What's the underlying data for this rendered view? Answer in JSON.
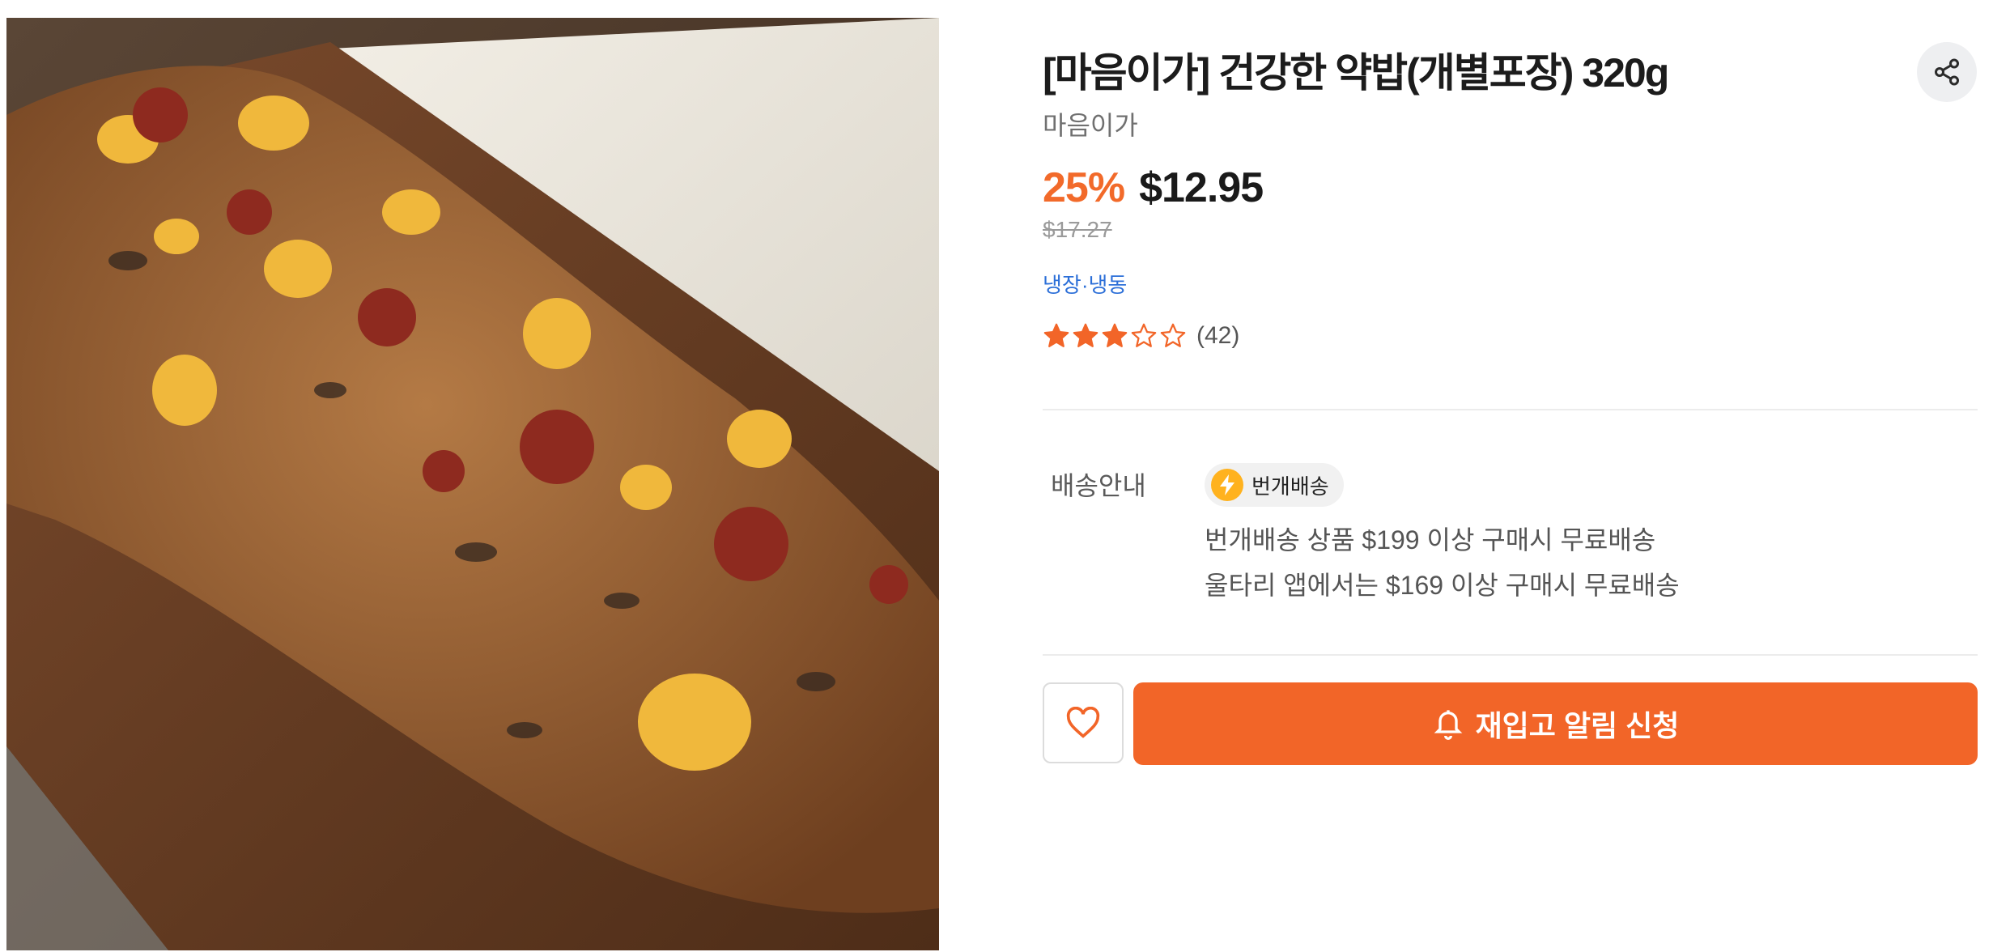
{
  "product": {
    "title": "[마음이가] 건강한 약밥(개별포장) 320g",
    "brand": "마음이가",
    "discount": "25%",
    "price": "$12.95",
    "original_price": "$17.27",
    "storage": "냉장·냉동",
    "rating": {
      "value": 3,
      "max": 5,
      "count_text": "(42)"
    }
  },
  "shipping": {
    "label": "배송안내",
    "badge": "번개배송",
    "lines": [
      "번개배송 상품 $199 이상 구매시 무료배송",
      "울타리 앱에서는 $169 이상 구매시 무료배송"
    ]
  },
  "actions": {
    "notify_label": "재입고 알림 신청"
  },
  "colors": {
    "accent": "#f26528",
    "discount": "#f26a2a",
    "link": "#2c6fd8",
    "badge_icon": "#ffb21e"
  },
  "icons": {
    "share": "share-icon",
    "heart": "heart-icon",
    "bell": "bell-icon",
    "bolt": "lightning-icon"
  }
}
